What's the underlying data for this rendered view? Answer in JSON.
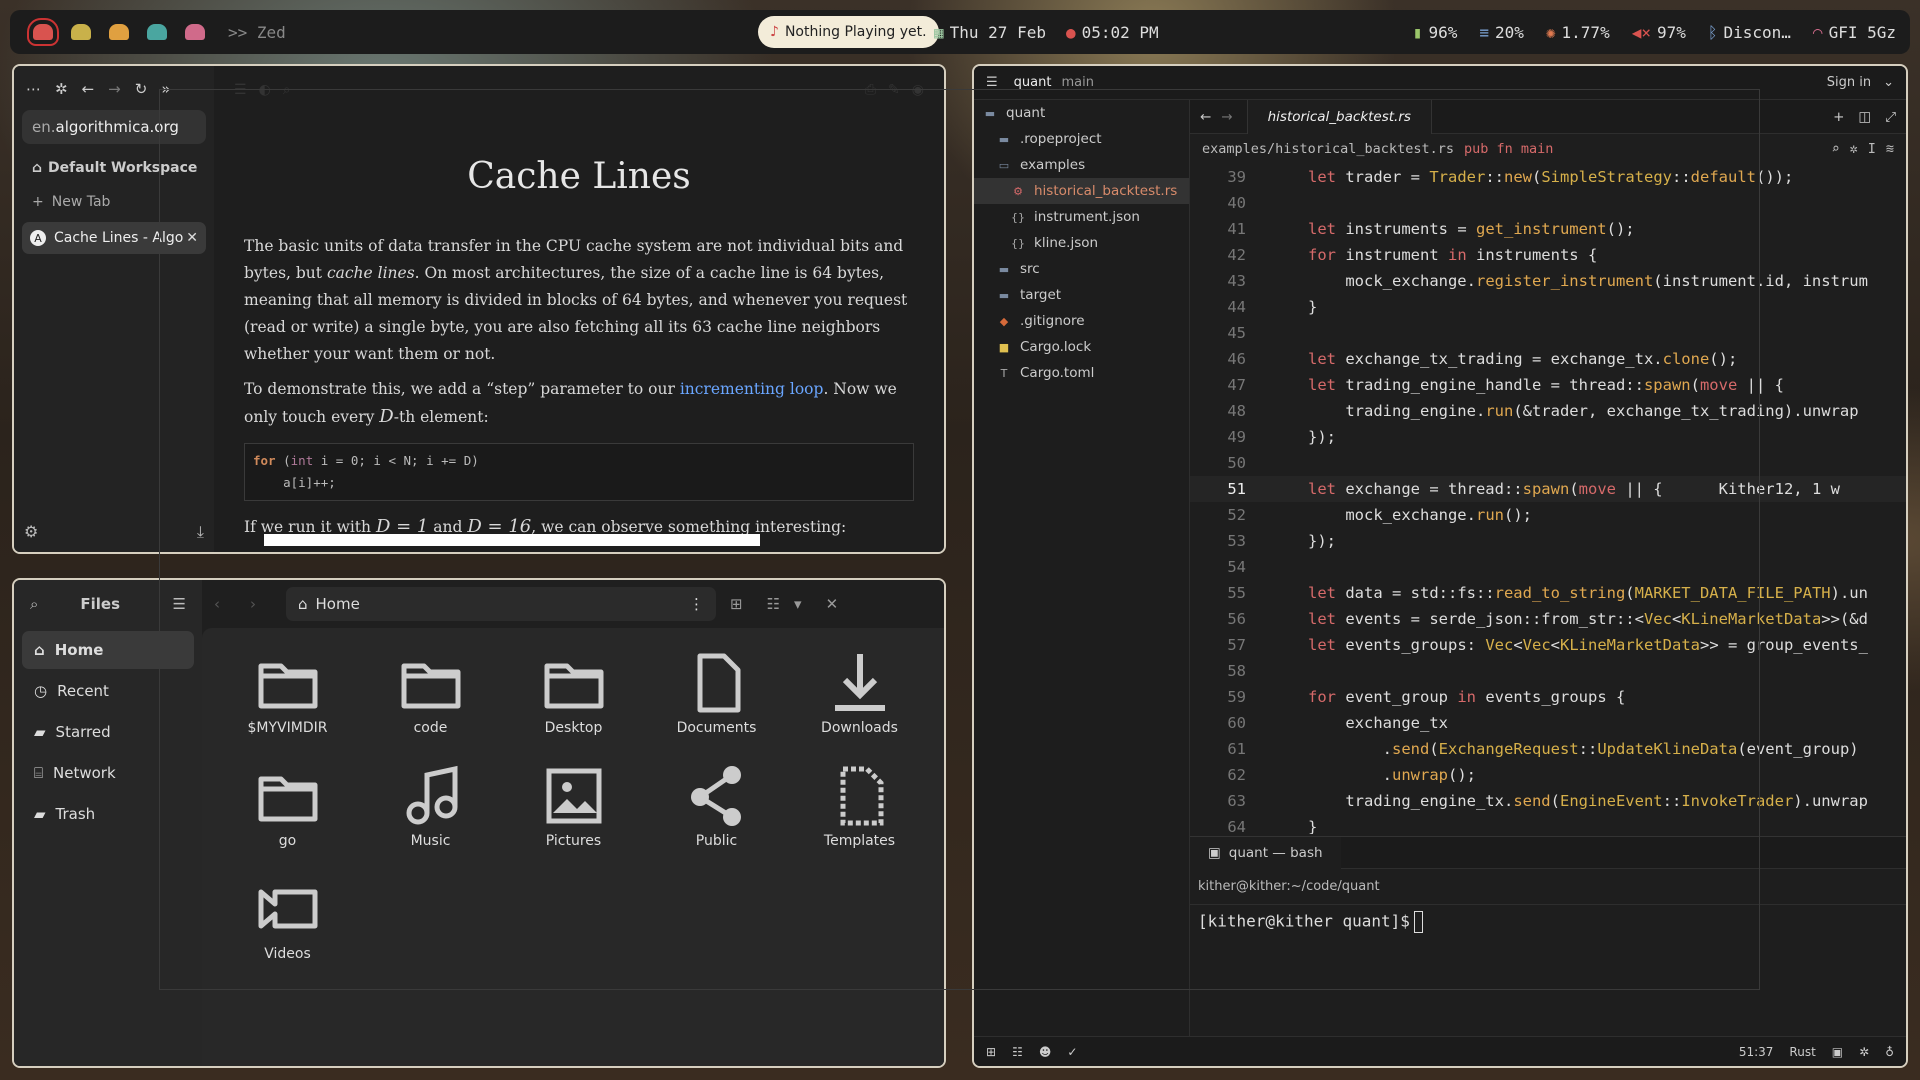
{
  "topbar": {
    "workspace_label": ">> Zed",
    "media": "Nothing Playing yet.",
    "date": "Thu 27 Feb",
    "time": "05:02 PM",
    "battery": "96%",
    "memory": "20%",
    "cpu": "1.77%",
    "volume": "97%",
    "bluetooth": "Discon…",
    "wifi": "GFI 5Gz",
    "ghost_colors": [
      "#d9534f",
      "#c9b14a",
      "#e0a040",
      "#4aa6a0",
      "#d06a8a"
    ]
  },
  "browser": {
    "url_prefix": "en.",
    "url_domain": "algorithmica.org",
    "workspace": "Default Workspace",
    "new_tab": "New Tab",
    "tab_label": "Cache Lines - Algo",
    "tab_favicon": "A",
    "article": {
      "title": "Cache Lines",
      "p1a": "The basic units of data transfer in the CPU cache system are not individual bits and bytes, but ",
      "p1em": "cache lines",
      "p1b": ". On most architectures, the size of a cache line is 64 bytes, meaning that all memory is divided in blocks of 64 bytes, and whenever you request (read or write) a single byte, you are also fetching all its 63 cache line neighbors whether your want them or not.",
      "p2a": "To demonstrate this, we add a “step” parameter to our ",
      "p2link": "incrementing loop",
      "p2b": ". Now we only touch every ",
      "p2var": "D",
      "p2c": "-th element:",
      "code_for": "for",
      "code_int": "int",
      "code_rest": " i = 0; i < N; i += D)",
      "code_open": " (",
      "code_line2": "    a[i]++;",
      "p3a": "If we run it with ",
      "p3b": "D = 1",
      "p3c": " and ",
      "p3d": "D = 16",
      "p3e": ", we can observe something interesting:"
    }
  },
  "files": {
    "title": "Files",
    "location": "Home",
    "sidebar": [
      {
        "label": "Home",
        "icon": "home-icon"
      },
      {
        "label": "Recent",
        "icon": "clock-icon"
      },
      {
        "label": "Starred",
        "icon": "star-icon"
      },
      {
        "label": "Network",
        "icon": "network-icon"
      },
      {
        "label": "Trash",
        "icon": "trash-icon"
      }
    ],
    "items": [
      {
        "label": "$MYVIMDIR",
        "icon": "folder"
      },
      {
        "label": "code",
        "icon": "folder"
      },
      {
        "label": "Desktop",
        "icon": "folder"
      },
      {
        "label": "Documents",
        "icon": "document"
      },
      {
        "label": "Downloads",
        "icon": "download"
      },
      {
        "label": "go",
        "icon": "folder"
      },
      {
        "label": "Music",
        "icon": "music"
      },
      {
        "label": "Pictures",
        "icon": "picture"
      },
      {
        "label": "Public",
        "icon": "share"
      },
      {
        "label": "Templates",
        "icon": "template"
      },
      {
        "label": "Videos",
        "icon": "video"
      }
    ]
  },
  "zed": {
    "project": "quant",
    "branch": "main",
    "sign_in": "Sign in",
    "tab": "historical_backtest.rs",
    "breadcrumb_path": "examples/historical_backtest.rs",
    "breadcrumb_symbol": "pub fn main",
    "tree": [
      {
        "label": "quant",
        "type": "root"
      },
      {
        "label": ".ropeproject",
        "type": "folder"
      },
      {
        "label": "examples",
        "type": "folder-open"
      },
      {
        "label": "historical_backtest.rs",
        "type": "rust"
      },
      {
        "label": "instrument.json",
        "type": "json"
      },
      {
        "label": "kline.json",
        "type": "json"
      },
      {
        "label": "src",
        "type": "folder"
      },
      {
        "label": "target",
        "type": "folder"
      },
      {
        "label": ".gitignore",
        "type": "git"
      },
      {
        "label": "Cargo.lock",
        "type": "lock"
      },
      {
        "label": "Cargo.toml",
        "type": "toml"
      }
    ],
    "code": [
      {
        "n": "39",
        "t": "let trader = Trader::new(SimpleStrategy::default());"
      },
      {
        "n": "40",
        "t": ""
      },
      {
        "n": "41",
        "t": "let instruments = get_instrument();"
      },
      {
        "n": "42",
        "t": "for instrument in instruments {"
      },
      {
        "n": "43",
        "t": "    mock_exchange.register_instrument(instrument.id, instrum"
      },
      {
        "n": "44",
        "t": "}"
      },
      {
        "n": "45",
        "t": ""
      },
      {
        "n": "46",
        "t": "let exchange_tx_trading = exchange_tx.clone();"
      },
      {
        "n": "47",
        "t": "let trading_engine_handle = thread::spawn(move || {"
      },
      {
        "n": "48",
        "t": "    trading_engine.run(&trader, exchange_tx_trading).unwrap"
      },
      {
        "n": "49",
        "t": "});"
      },
      {
        "n": "50",
        "t": ""
      },
      {
        "n": "51",
        "t": "let exchange = thread::spawn(move || {      Kither12, 1 w"
      },
      {
        "n": "52",
        "t": "    mock_exchange.run();"
      },
      {
        "n": "53",
        "t": "});"
      },
      {
        "n": "54",
        "t": ""
      },
      {
        "n": "55",
        "t": "let data = std::fs::read_to_string(MARKET_DATA_FILE_PATH).un"
      },
      {
        "n": "56",
        "t": "let events = serde_json::from_str::<Vec<KLineMarketData>>(&d"
      },
      {
        "n": "57",
        "t": "let events_groups: Vec<Vec<KLineMarketData>> = group_events_"
      },
      {
        "n": "58",
        "t": ""
      },
      {
        "n": "59",
        "t": "for event_group in events_groups {"
      },
      {
        "n": "60",
        "t": "    exchange_tx"
      },
      {
        "n": "61",
        "t": "        .send(ExchangeRequest::UpdateKlineData(event_group)"
      },
      {
        "n": "62",
        "t": "        .unwrap();"
      },
      {
        "n": "63",
        "t": "    trading_engine_tx.send(EngineEvent::InvokeTrader).unwrap"
      },
      {
        "n": "64",
        "t": "}"
      }
    ],
    "terminal_tab": "quant — bash",
    "terminal_title": "kither@kither:~/code/quant",
    "prompt": "[kither@kither quant]$",
    "cursor_pos": "51:37",
    "language": "Rust"
  }
}
